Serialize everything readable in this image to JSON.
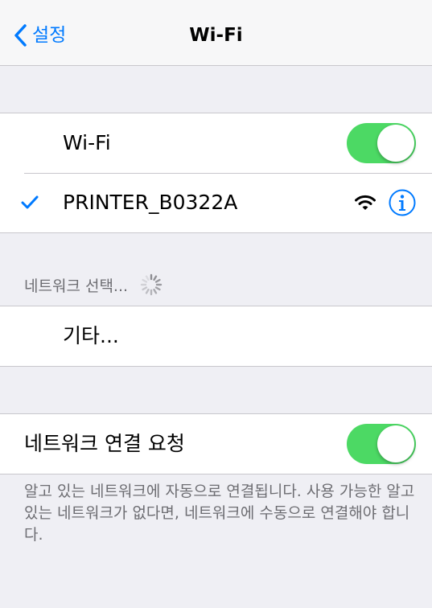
{
  "navbar": {
    "back_label": "설정",
    "title": "Wi-Fi"
  },
  "wifi": {
    "label": "Wi-Fi",
    "enabled": true
  },
  "connected_network": {
    "name": "PRINTER_B0322A",
    "signal_icon": "wifi-icon",
    "info_icon": "info-icon",
    "check_icon": "checkmark-icon"
  },
  "networks_section": {
    "header": "네트워크 선택...",
    "loading_icon": "spinner-icon"
  },
  "other_network": {
    "label": "기타..."
  },
  "ask_to_join": {
    "label": "네트워크 연결 요청",
    "enabled": true,
    "footer": "알고 있는 네트워크에 자동으로 연결됩니다. 사용 가능한 알고 있는 네트워크가 없다면, 네트워크에 수동으로 연결해야 합니다."
  },
  "colors": {
    "accent": "#007aff",
    "toggle_on": "#4cd964",
    "background": "#efeff4",
    "separator": "#c8c7cc",
    "secondary_text": "#6d6d72"
  }
}
